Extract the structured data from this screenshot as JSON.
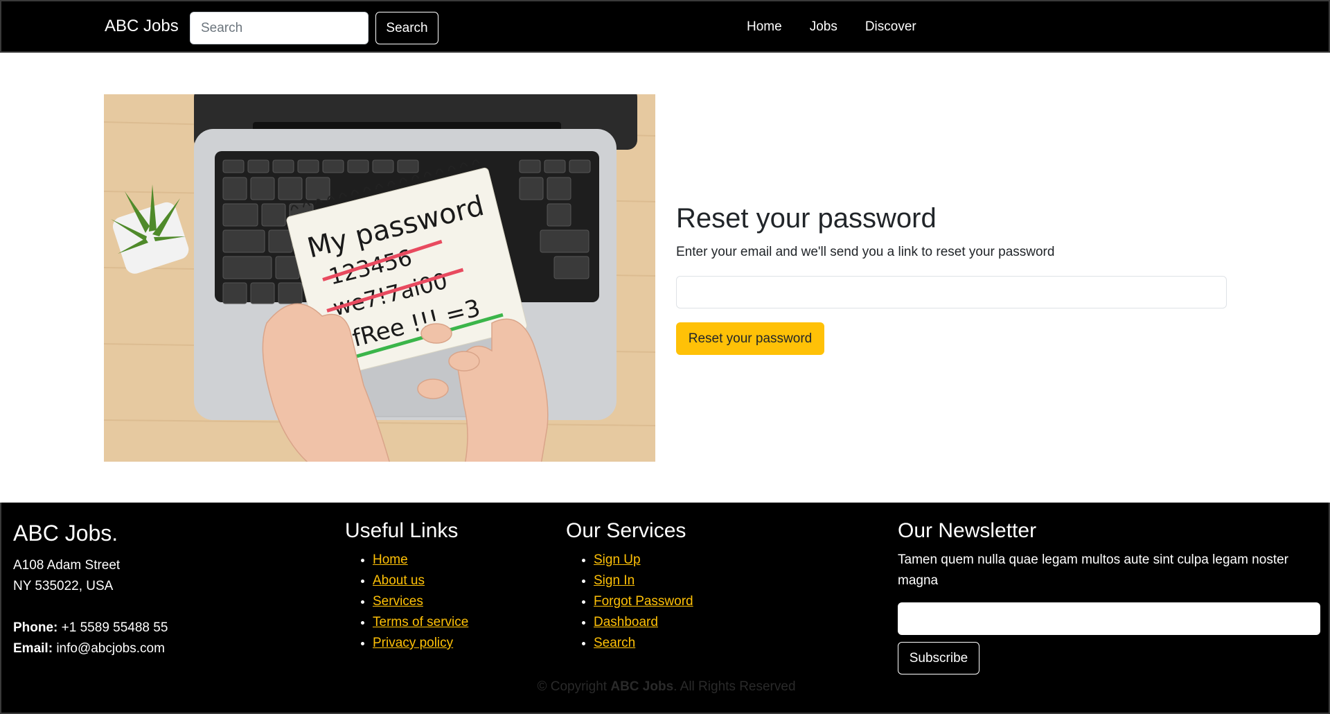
{
  "nav": {
    "brand": "ABC Jobs",
    "search_placeholder": "Search",
    "search_button": "Search",
    "links": [
      "Home",
      "Jobs",
      "Discover"
    ]
  },
  "main": {
    "image": {
      "notebook_lines": [
        "My password",
        "123456",
        "we7!7ai00",
        "ufRee !!! =3"
      ]
    },
    "title": "Reset your password",
    "description": "Enter your email and we'll send you a link to reset your password",
    "email_value": "",
    "button": "Reset your password"
  },
  "footer": {
    "brand": "ABC Jobs.",
    "address_line1": "A108 Adam Street",
    "address_line2": "NY 535022, USA",
    "phone_label": "Phone:",
    "phone": "+1 5589 55488 55",
    "email_label": "Email:",
    "email": "info@abcjobs.com",
    "useful_links": {
      "title": "Useful Links",
      "items": [
        "Home",
        "About us",
        "Services",
        "Terms of service",
        "Privacy policy"
      ]
    },
    "services": {
      "title": "Our Services",
      "items": [
        "Sign Up",
        "Sign In",
        "Forgot Password",
        "Dashboard",
        "Search"
      ]
    },
    "newsletter": {
      "title": "Our Newsletter",
      "text": "Tamen quem nulla quae legam multos aute sint culpa legam noster magna",
      "input_value": "",
      "button": "Subscribe"
    },
    "copyright_prefix": "© Copyright",
    "copyright_brand": "ABC Jobs",
    "copyright_suffix": ". All Rights Reserved"
  },
  "colors": {
    "accent": "#ffc107",
    "nav_bg": "#000000",
    "footer_bg": "#000000"
  }
}
